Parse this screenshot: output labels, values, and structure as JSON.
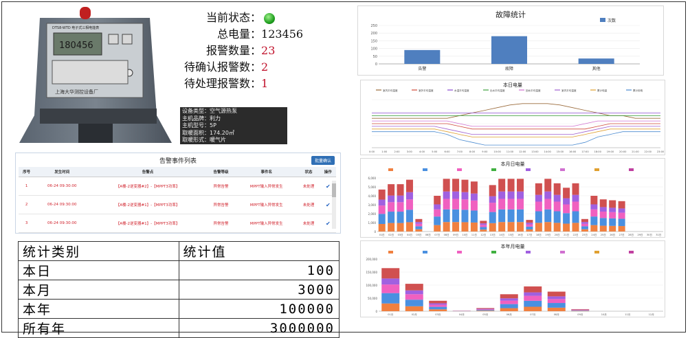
{
  "status": {
    "state_label": "当前状态：",
    "total_label": "总电量：",
    "total_value": "123456",
    "alarm_label": "报警数量：",
    "alarm_value": "23",
    "confirm_label": "待确认报警数：",
    "confirm_value": "2",
    "pending_label": "待处理报警数：",
    "pending_value": "1",
    "led_color": "#22aa22"
  },
  "meter": {
    "display": "180456",
    "model_line": "DTS8-WTD 电子式三相电能表",
    "nameplate": "上海大华测控设备厂"
  },
  "device_info": {
    "lines": [
      "设备类型：空气源热泵",
      "主机品牌：利力",
      "主机型号：5P",
      "取暖面积：174.20㎡",
      "取暖形式：暖气片"
    ]
  },
  "alarm_table": {
    "title": "告警事件列表",
    "batch_button": "批量确认",
    "headers": [
      "序号",
      "发生时间",
      "告警点",
      "告警等级",
      "事件名",
      "状态",
      "操作"
    ],
    "rows": [
      {
        "no": "1",
        "time": "06-24 09:30:00",
        "point": "【A楼-2逆变器#2】-【MPPT3功率】",
        "level": "异常告警",
        "event": "MPPT输入异常发生",
        "status": "未处理"
      },
      {
        "no": "2",
        "time": "06-24 09:30:00",
        "point": "【A楼-2逆变器#1】-【MPPT3功率】",
        "level": "异常告警",
        "event": "MPPT输入异常发生",
        "status": "未处理"
      },
      {
        "no": "3",
        "time": "06-24 09:30:00",
        "point": "【A楼-2逆变器#1】-【MPPT3功率】",
        "level": "异常告警",
        "event": "MPPT输入异常发生",
        "status": "未处理"
      }
    ]
  },
  "stats_table": {
    "header_category": "统计类别",
    "header_value": "统计值",
    "rows": [
      {
        "category": "本日",
        "value": "100"
      },
      {
        "category": "本月",
        "value": "3000"
      },
      {
        "category": "本年",
        "value": "100000"
      },
      {
        "category": "所有年",
        "value": "3000000"
      }
    ]
  },
  "chart_data": [
    {
      "type": "bar",
      "title": "故障统计",
      "legend": "次数",
      "categories": [
        "告警",
        "故障",
        "其他"
      ],
      "values": [
        90,
        180,
        35
      ],
      "yticks": [
        "0",
        "50",
        "100",
        "150",
        "200",
        "250"
      ],
      "ylim": [
        0,
        250
      ],
      "color": "#4f7fbf"
    },
    {
      "type": "line",
      "title": "本日电量",
      "series_labels": [
        "室内平均温度",
        "室外平均温度",
        "水温平均温度",
        "出水平均温度",
        "回水平均温度",
        "室内平均温度",
        "累计电量",
        "累计用电"
      ],
      "x": [
        "0:00",
        "1:00",
        "2:00",
        "3:00",
        "4:00",
        "5:00",
        "6:00",
        "7:00",
        "8:00",
        "9:00",
        "10:00",
        "11:00",
        "12:00",
        "13:00",
        "14:00",
        "15:00",
        "16:00",
        "17:00",
        "18:00",
        "19:00",
        "20:00",
        "21:00",
        "22:00",
        "23:00"
      ],
      "colors": [
        "#9a6a3a",
        "#d04a3a",
        "#8a4ad0",
        "#40a040",
        "#d070d0",
        "#a060d0",
        "#e0a030",
        "#4a8ad0"
      ],
      "series": [
        {
          "values": [
            19,
            19,
            19,
            19,
            19,
            19,
            19,
            20,
            21,
            22,
            23,
            24,
            24.5,
            24.5,
            24.5,
            24,
            23,
            22,
            21,
            20,
            20,
            19,
            19,
            19
          ]
        },
        {
          "values": [
            17,
            17,
            17,
            17,
            17,
            17,
            17,
            16,
            15,
            15,
            15,
            15,
            15,
            15,
            15,
            15,
            15,
            15,
            16,
            17,
            17,
            17,
            17,
            17
          ]
        },
        {
          "values": [
            21,
            21,
            21,
            21,
            21,
            21,
            21,
            21,
            21,
            21,
            21,
            21,
            21,
            21,
            21,
            21,
            21,
            21,
            21,
            21,
            21,
            21,
            21,
            21
          ]
        },
        {
          "values": [
            20,
            20,
            20,
            20,
            20,
            20,
            20,
            20,
            20,
            20,
            20,
            20,
            20,
            20,
            20,
            20,
            20,
            20,
            20,
            20,
            20,
            20,
            20,
            20
          ]
        },
        {
          "values": [
            18,
            18,
            18,
            18,
            18,
            18,
            18,
            17,
            16,
            16,
            16,
            16,
            16,
            16,
            16,
            16,
            16,
            17,
            18,
            18,
            18,
            18,
            18,
            18
          ]
        },
        {
          "values": [
            16,
            16,
            16,
            16,
            16,
            16,
            15,
            14,
            13,
            13,
            13,
            13,
            13,
            13,
            13,
            13,
            13,
            14,
            15,
            16,
            16,
            16,
            16,
            16
          ]
        },
        {
          "values": [
            15,
            15,
            15,
            15,
            15,
            15,
            14,
            13,
            12,
            12,
            12,
            12,
            12,
            12,
            12,
            12,
            12,
            13,
            14,
            15,
            15,
            15,
            15,
            15
          ]
        },
        {
          "values": [
            14,
            14,
            14,
            14,
            14,
            14,
            13,
            11,
            10,
            9,
            9,
            9,
            9,
            9,
            9,
            9,
            9,
            10,
            12,
            13,
            14,
            14,
            14,
            14
          ]
        }
      ]
    },
    {
      "type": "bar",
      "stacked": true,
      "title": "本月日电量",
      "yticks": [
        "0",
        "1,000",
        "2,000",
        "3,000",
        "4,000",
        "5,000",
        "6,000"
      ],
      "ylim": [
        0,
        6000
      ],
      "categories": [
        "01日",
        "02日",
        "03日",
        "04日",
        "05日",
        "06日",
        "07日",
        "08日",
        "09日",
        "10日",
        "11日",
        "12日",
        "13日",
        "14日",
        "15日",
        "16日",
        "17日",
        "18日",
        "19日",
        "20日",
        "21日",
        "22日",
        "23日",
        "24日",
        "25日",
        "26日",
        "27日",
        "28日",
        "29日",
        "30日",
        "31日"
      ],
      "colors": [
        "#f08040",
        "#4a90e0",
        "#f060c0",
        "#a060e0",
        "#d05050"
      ],
      "totals": [
        4700,
        5300,
        5300,
        5800,
        1400,
        0,
        4000,
        5900,
        5900,
        5800,
        5600,
        1200,
        5200,
        5900,
        5900,
        5900,
        1300,
        5400,
        5900,
        5400,
        4900,
        5400,
        1400,
        4000,
        3600,
        3500,
        3400,
        0,
        0,
        0,
        0
      ]
    },
    {
      "type": "bar",
      "stacked": true,
      "title": "本年月电量",
      "yticks": [
        "0",
        "50,000",
        "100,000",
        "150,000",
        "200,000"
      ],
      "ylim": [
        0,
        200000
      ],
      "categories": [
        "01月",
        "02月",
        "03月",
        "04月",
        "05月",
        "06月",
        "07月",
        "08月",
        "09月",
        "10月",
        "11月",
        "12月"
      ],
      "colors": [
        "#f08040",
        "#4a90e0",
        "#f060c0",
        "#a060e0",
        "#d05050"
      ],
      "totals": [
        165000,
        105000,
        40000,
        2000,
        12000,
        65000,
        95000,
        75000,
        8000,
        0,
        0,
        0
      ]
    }
  ]
}
